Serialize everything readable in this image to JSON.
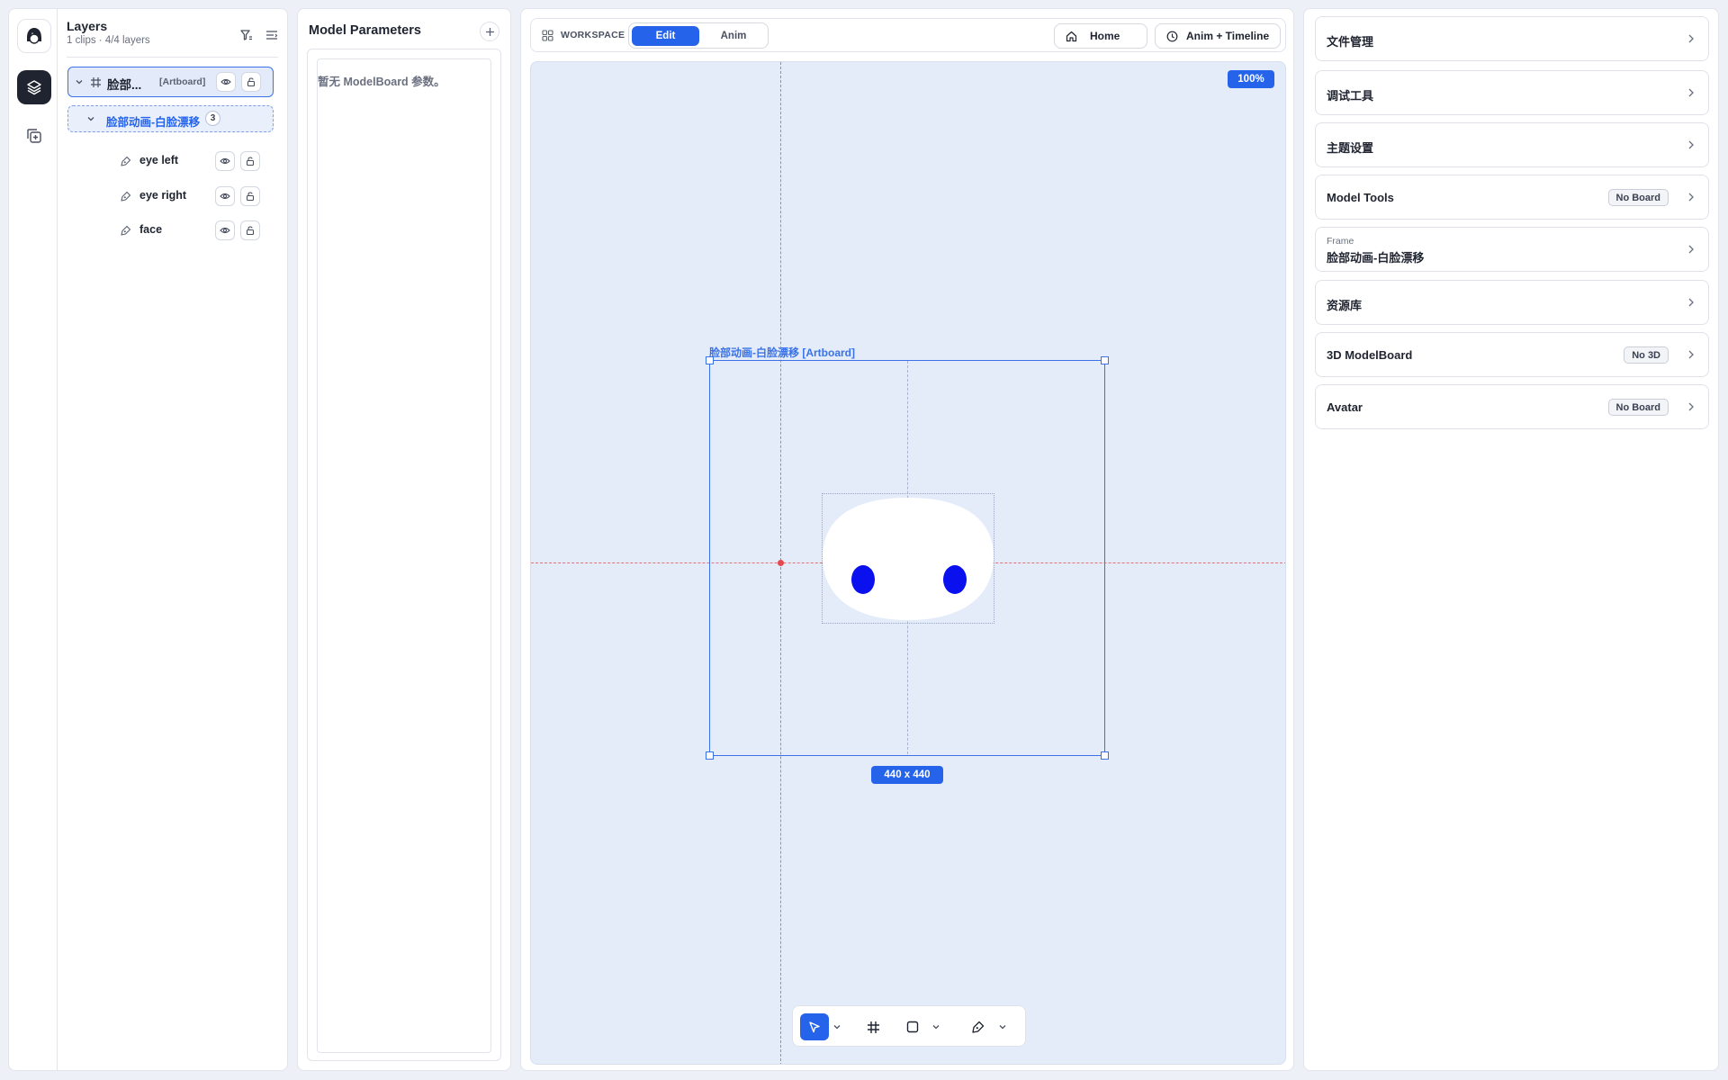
{
  "layers": {
    "title": "Layers",
    "subtitle": "1 clips · 4/4 layers",
    "artboard": {
      "name": "脸部...",
      "tag": "[Artboard]"
    },
    "group": {
      "name": "脸部动画-白脸漂移",
      "count": "3"
    },
    "items": [
      {
        "label": "eye left"
      },
      {
        "label": "eye right"
      },
      {
        "label": "face"
      }
    ]
  },
  "params": {
    "title": "Model Parameters",
    "empty_text": "暂无 ModelBoard 参数。"
  },
  "workspace": {
    "label": "WORKSPACE",
    "tabs": [
      "Edit",
      "Anim"
    ],
    "active_tab": "Edit",
    "home_label": "Home",
    "timeline_label": "Anim + Timeline",
    "zoom": "100%",
    "artboard_label": "脸部动画-白脸漂移 [Artboard]",
    "artboard_size": "440 x 440"
  },
  "right_panel": {
    "cards": [
      {
        "label": "文件管理"
      },
      {
        "label": "调试工具"
      },
      {
        "label": "主题设置"
      },
      {
        "label": "Model Tools",
        "badge": "No Board"
      },
      {
        "kicker": "Frame",
        "label": "脸部动画-白脸漂移"
      },
      {
        "label": "资源库"
      },
      {
        "label": "3D ModelBoard",
        "badge": "No 3D"
      },
      {
        "label": "Avatar",
        "badge": "No Board"
      }
    ]
  },
  "colors": {
    "accent": "#2563eb",
    "guide": "#e5484d",
    "eye": "#0a10ee",
    "canvas": "#e4ecfa"
  }
}
